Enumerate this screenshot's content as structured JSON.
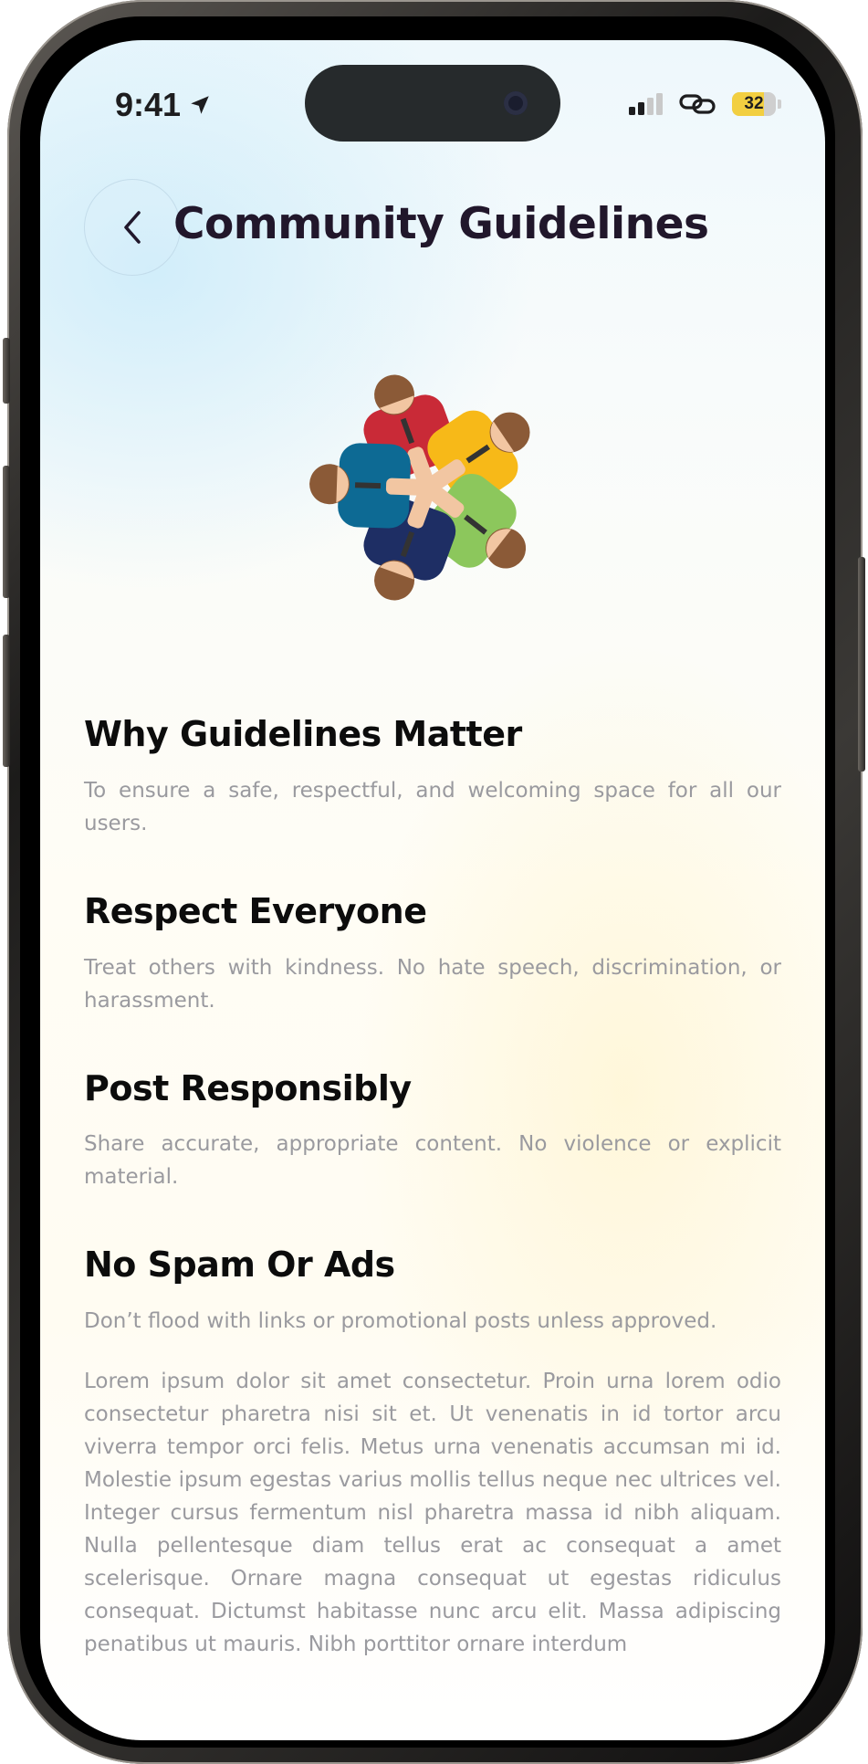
{
  "status_bar": {
    "time": "9:41",
    "battery_level": "32",
    "battery_fraction": 0.72
  },
  "header": {
    "back_icon": "chevron-left-icon",
    "title": "Community Guidelines"
  },
  "illustration": {
    "icon": "team-hands-together-icon",
    "colors": [
      "#c92a37",
      "#f7b918",
      "#8cc75c",
      "#1e2e64",
      "#0d6a94",
      "#8b5a37",
      "#f2c6a2"
    ]
  },
  "sections": [
    {
      "heading": "Why Guidelines Matter",
      "body": "To ensure a safe, respectful, and welcoming space for all our users."
    },
    {
      "heading": "Respect Everyone",
      "body": "Treat others with kindness. No hate speech, discrimination, or harassment."
    },
    {
      "heading": "Post Responsibly",
      "body": "Share accurate, appropriate content. No violence or explicit material."
    },
    {
      "heading": "No Spam Or Ads",
      "body": "Don’t flood with links or promotional posts unless approved."
    }
  ],
  "lorem": "Lorem ipsum dolor sit amet consectetur. Proin urna lorem odio consectetur pharetra nisi sit et. Ut venenatis in id tortor arcu viverra tempor orci felis. Metus urna venenatis accumsan mi id. Molestie ipsum egestas varius mollis tellus neque nec ultrices vel. Integer cursus fermentum nisl pharetra massa id nibh aliquam. Nulla pellentesque diam tellus erat ac consequat a amet scelerisque. Ornare magna consequat ut egestas ridiculus consequat. Dictumst habitasse nunc arcu elit. Massa adipiscing penatibus ut mauris. Nibh porttitor ornare interdum"
}
